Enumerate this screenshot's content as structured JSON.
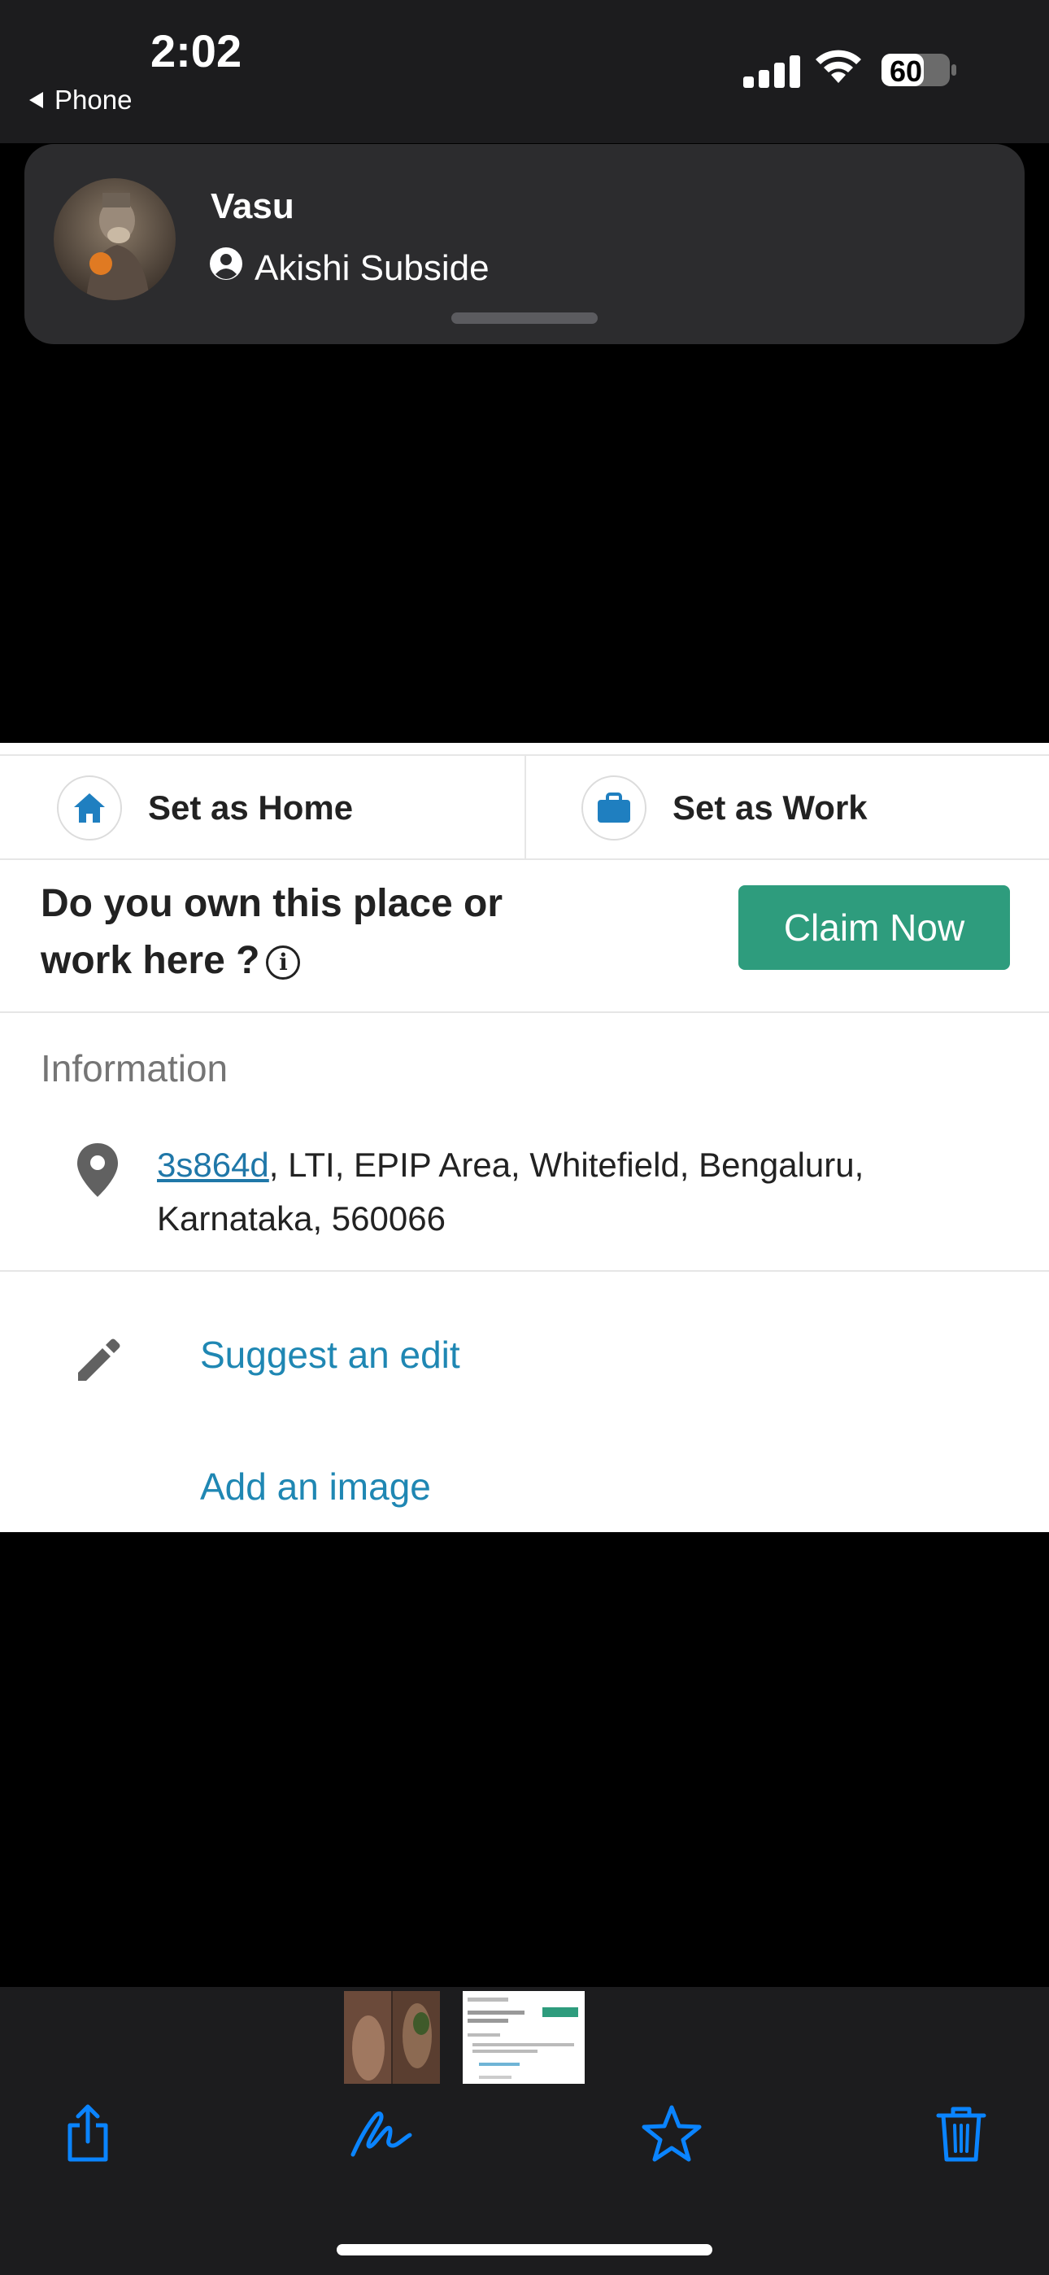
{
  "status_bar": {
    "time": "2:02",
    "back_app": "Phone",
    "battery": "60"
  },
  "notification": {
    "title": "Vasu",
    "subtitle": "Akishi Subside"
  },
  "quick_actions": {
    "home_label": "Set as Home",
    "work_label": "Set as Work"
  },
  "claim": {
    "question": "Do you own this place or work here ?",
    "button_label": "Claim Now"
  },
  "information": {
    "heading": "Information",
    "address_code": "3s864d",
    "address_rest": ", LTI, EPIP Area, Whitefield, Bengaluru, Karnataka, 560066"
  },
  "actions": {
    "suggest_edit": "Suggest an edit",
    "add_image": "Add an image"
  },
  "toolbar": {
    "icons": [
      "share-icon",
      "markup-icon",
      "favorite-icon",
      "delete-icon"
    ]
  },
  "colors": {
    "accent_blue": "#0a84ff",
    "claim_green": "#2e9c7d",
    "link_blue": "#1f87b3"
  }
}
